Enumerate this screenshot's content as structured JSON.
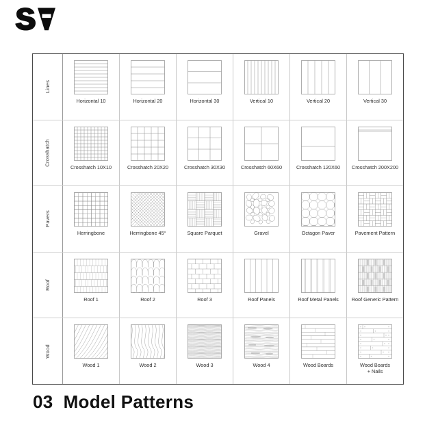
{
  "brand": {
    "logo_text": "SA",
    "logo_name": "sa-logo"
  },
  "footer": {
    "title": "03  Model Patterns"
  },
  "table": {
    "rows": [
      {
        "label": "Lines",
        "cells": [
          {
            "caption": "Horizontal 10",
            "pattern": "horizontal-10"
          },
          {
            "caption": "Horizontal 20",
            "pattern": "horizontal-20"
          },
          {
            "caption": "Horizontal 30",
            "pattern": "horizontal-30"
          },
          {
            "caption": "Vertical 10",
            "pattern": "vertical-10"
          },
          {
            "caption": "Vertical 20",
            "pattern": "vertical-20"
          },
          {
            "caption": "Vertical 30",
            "pattern": "vertical-30"
          }
        ]
      },
      {
        "label": "Crosshatch",
        "cells": [
          {
            "caption": "Crosshatch 10X10",
            "pattern": "crosshatch-10x10"
          },
          {
            "caption": "Crosshatch 20X20",
            "pattern": "crosshatch-20x20"
          },
          {
            "caption": "Crosshatch 30X30",
            "pattern": "crosshatch-30x30"
          },
          {
            "caption": "Crosshatch 60X60",
            "pattern": "crosshatch-60x60"
          },
          {
            "caption": "Crosshatch 120X60",
            "pattern": "crosshatch-120x60"
          },
          {
            "caption": "Crosshatch 200X200",
            "pattern": "crosshatch-200x200"
          }
        ]
      },
      {
        "label": "Pavers",
        "cells": [
          {
            "caption": "Herringbone",
            "pattern": "herringbone"
          },
          {
            "caption": "Herringbone 45°",
            "pattern": "herringbone-45"
          },
          {
            "caption": "Square Parquet",
            "pattern": "square-parquet"
          },
          {
            "caption": "Gravel",
            "pattern": "gravel"
          },
          {
            "caption": "Octagon Paver",
            "pattern": "octagon-paver"
          },
          {
            "caption": "Pavement Pattern",
            "pattern": "pavement-pattern"
          }
        ]
      },
      {
        "label": "Roof",
        "cells": [
          {
            "caption": "Roof 1",
            "pattern": "roof-1"
          },
          {
            "caption": "Roof 2",
            "pattern": "roof-2"
          },
          {
            "caption": "Roof 3",
            "pattern": "roof-3"
          },
          {
            "caption": "Roof Panels",
            "pattern": "roof-panels"
          },
          {
            "caption": "Roof Metal Panels",
            "pattern": "roof-metal-panels"
          },
          {
            "caption": "Roof Generic Pattern",
            "pattern": "roof-generic-pattern"
          }
        ]
      },
      {
        "label": "Wood",
        "cells": [
          {
            "caption": "Wood 1",
            "pattern": "wood-1"
          },
          {
            "caption": "Wood 2",
            "pattern": "wood-2"
          },
          {
            "caption": "Wood 3",
            "pattern": "wood-3"
          },
          {
            "caption": "Wood 4",
            "pattern": "wood-4"
          },
          {
            "caption": "Wood Boards",
            "pattern": "wood-boards"
          },
          {
            "caption": "Wood Boards\n+ Nails",
            "pattern": "wood-boards-nails"
          }
        ]
      }
    ]
  },
  "colors": {
    "table_border": "#4a4a4a",
    "cell_divider": "#c8c8c8",
    "row_divider": "#cfcfcf",
    "swatch_stroke": "#8c8c8c",
    "text": "#2e2e2e",
    "title": "#111111"
  }
}
